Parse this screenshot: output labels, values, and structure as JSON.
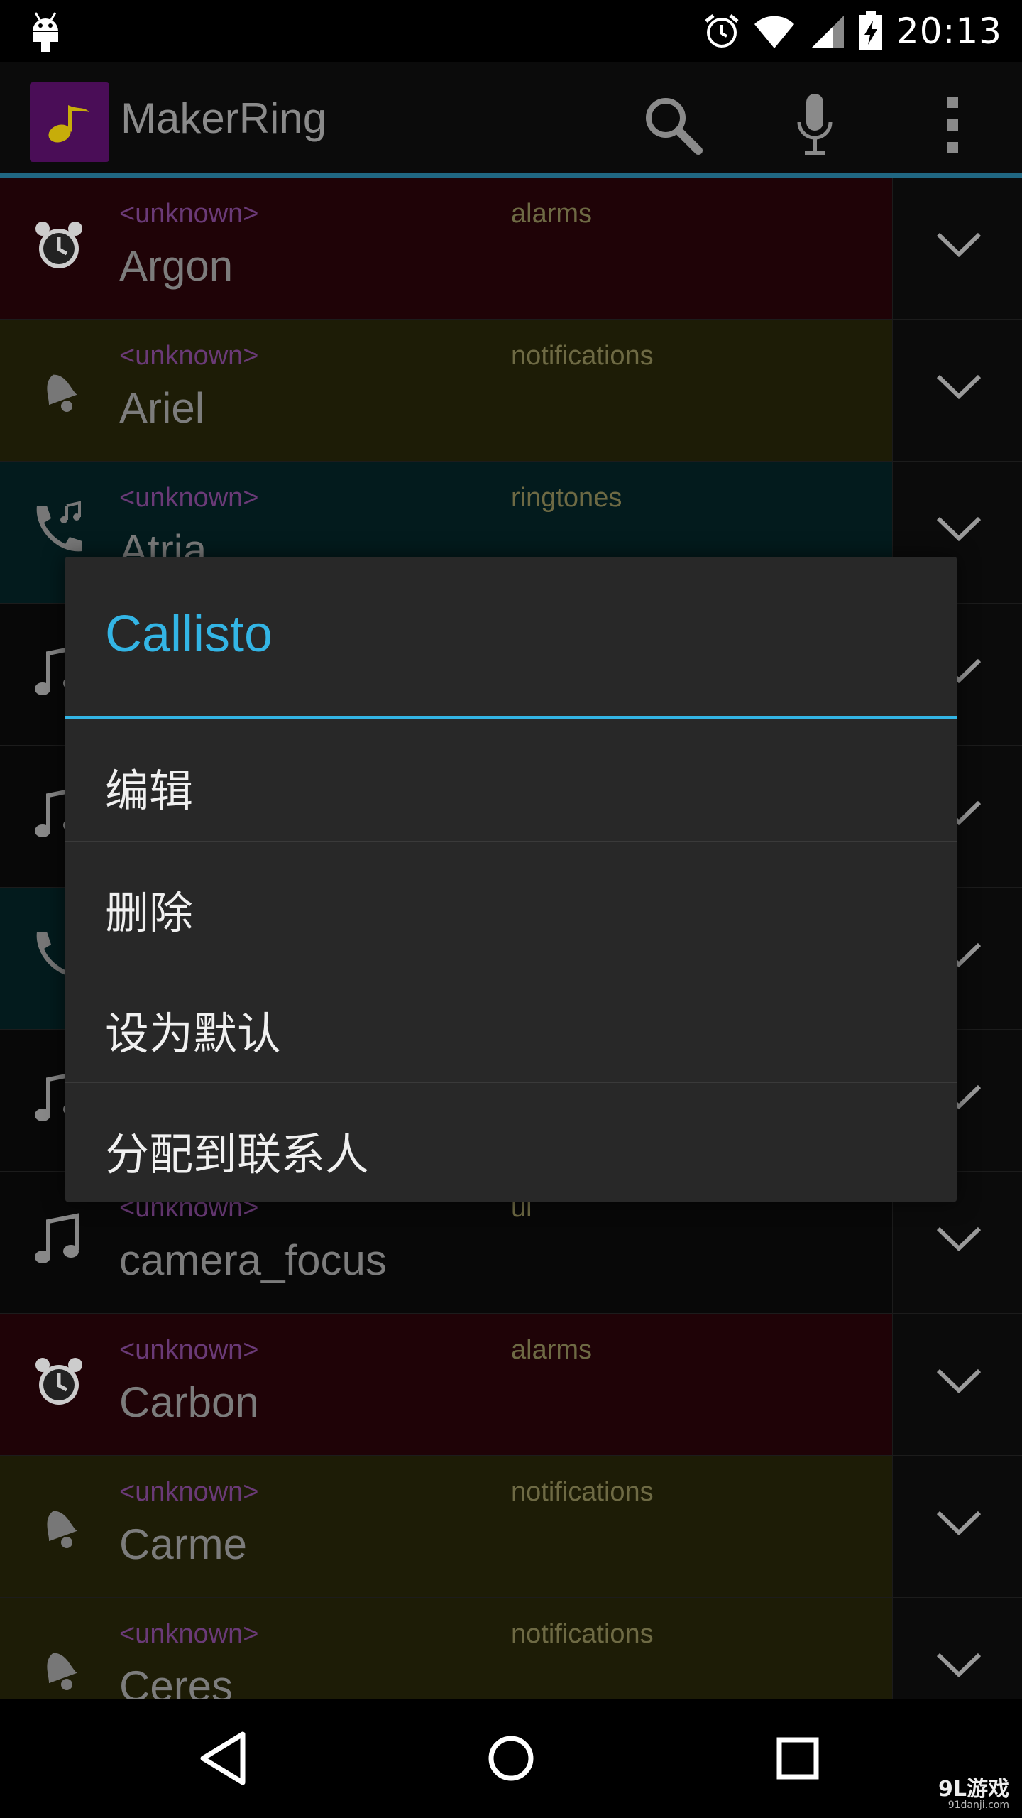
{
  "status_bar": {
    "time": "20:13",
    "icons": [
      "android-debug-icon",
      "alarm-icon",
      "wifi-icon",
      "signal-icon",
      "battery-charging-icon"
    ]
  },
  "action_bar": {
    "title": "MakerRing",
    "icons": [
      "app-music-note-icon",
      "search-icon",
      "microphone-icon",
      "overflow-menu-icon"
    ]
  },
  "list": {
    "rows": [
      {
        "artist": "<unknown>",
        "category": "alarms",
        "name": "Argon",
        "icon": "alarm-clock-icon"
      },
      {
        "artist": "<unknown>",
        "category": "notifications",
        "name": "Ariel",
        "icon": "bell-icon"
      },
      {
        "artist": "<unknown>",
        "category": "ringtones",
        "name": "Atria",
        "icon": "phone-ring-icon"
      },
      {
        "artist": "",
        "category": "",
        "name": "",
        "icon": "music-note-icon"
      },
      {
        "artist": "",
        "category": "",
        "name": "",
        "icon": "music-note-icon"
      },
      {
        "artist": "",
        "category": "",
        "name": "",
        "icon": "phone-ring-icon"
      },
      {
        "artist": "",
        "category": "",
        "name": "",
        "icon": "music-note-icon"
      },
      {
        "artist": "<unknown>",
        "category": "ui",
        "name": "camera_focus",
        "icon": "music-note-icon"
      },
      {
        "artist": "<unknown>",
        "category": "alarms",
        "name": "Carbon",
        "icon": "alarm-clock-icon"
      },
      {
        "artist": "<unknown>",
        "category": "notifications",
        "name": "Carme",
        "icon": "bell-icon"
      },
      {
        "artist": "<unknown>",
        "category": "notifications",
        "name": "Ceres",
        "icon": "bell-icon"
      }
    ]
  },
  "dialog": {
    "title": "Callisto",
    "items": [
      "编辑",
      "删除",
      "设为默认",
      "分配到联系人"
    ]
  },
  "nav_bar": {
    "icons": [
      "back-icon",
      "home-icon",
      "recent-apps-icon"
    ]
  },
  "watermark": {
    "logo": "9L游戏",
    "url": "91danji.com"
  },
  "colors": {
    "accent": "#33b5e5",
    "alarm_row": "#1f0307",
    "notification_row": "#1d1c06",
    "ringtone_row": "#031b1d",
    "ui_row": "#080808",
    "dialog_bg": "#282828"
  }
}
